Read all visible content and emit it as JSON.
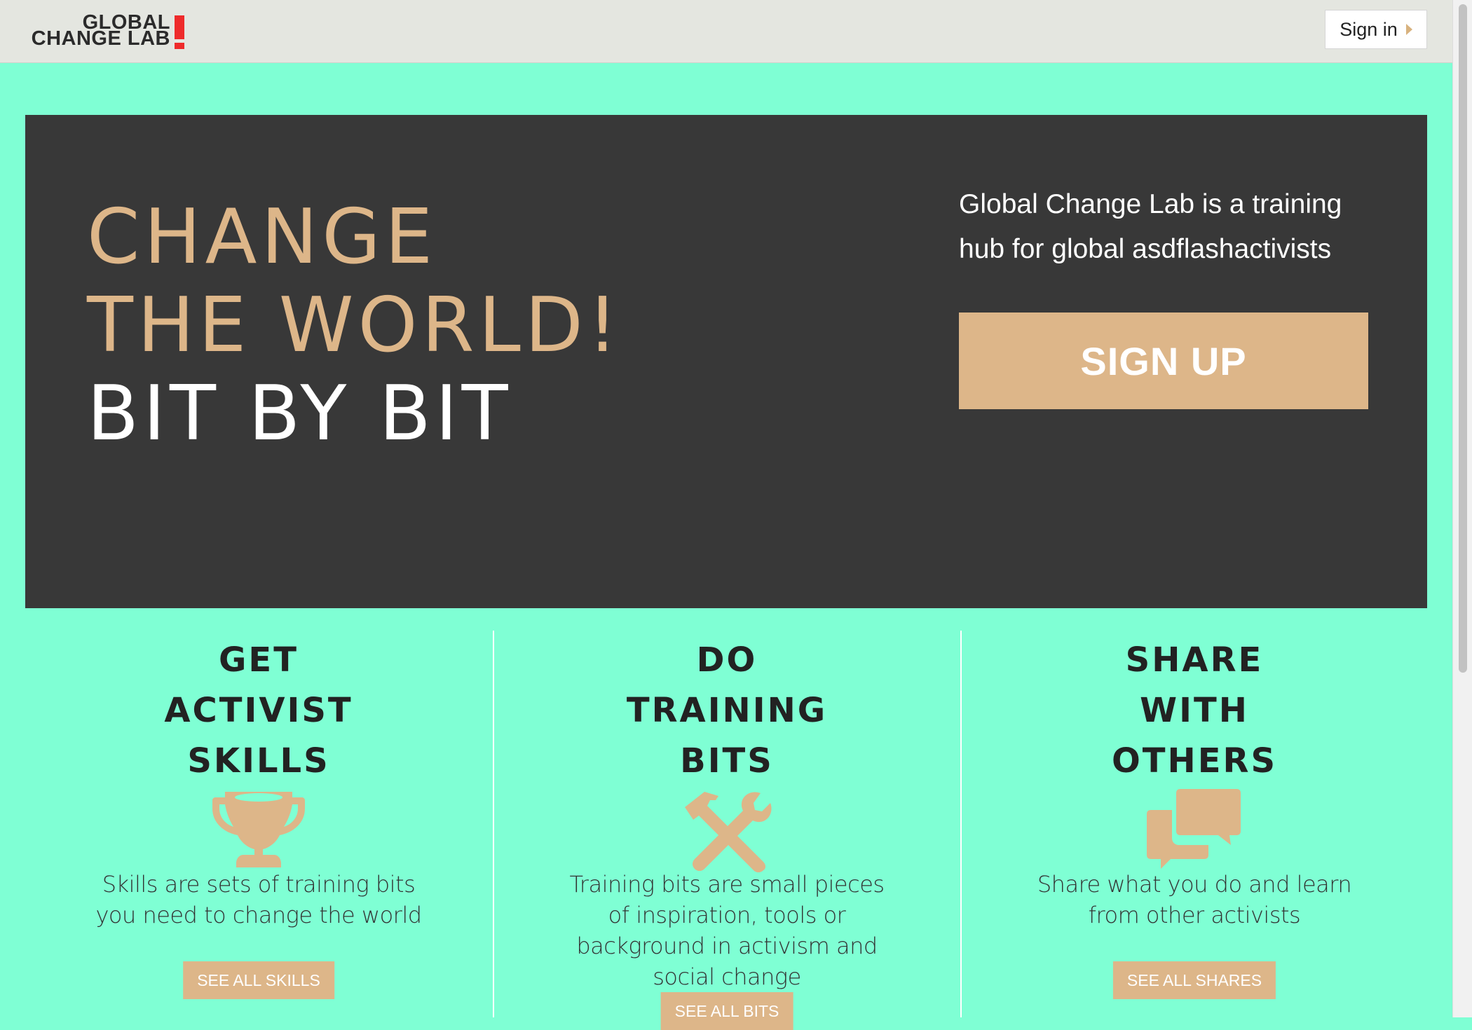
{
  "header": {
    "logo": {
      "line1": "GLOBAL",
      "line2": "CHANGE LAB"
    },
    "signin_label": "Sign in",
    "signin_icon": "caret-right-icon"
  },
  "hero": {
    "headline_line1": "CHANGE",
    "headline_line2": "THE WORLD!",
    "headline_line3": "BIT BY BIT",
    "intro": "Global Change Lab is a training hub for global asdflashactivists",
    "signup_label": "SIGN UP"
  },
  "features": [
    {
      "title": [
        "GET",
        "ACTIVIST",
        "SKILLS"
      ],
      "icon": "trophy-icon",
      "description": "Skills are sets of training bits you need to change the world",
      "button_label": "SEE ALL SKILLS"
    },
    {
      "title": [
        "DO",
        "TRAINING",
        "BITS"
      ],
      "icon": "hammer-wrench-icon",
      "description": "Training bits are small pieces of inspiration, tools or background in activism and social change",
      "button_label": "SEE ALL BITS"
    },
    {
      "title": [
        "SHARE",
        "WITH",
        "OTHERS"
      ],
      "icon": "speech-bubbles-icon",
      "description": "Share what you do and learn from other activists",
      "button_label": "SEE ALL SHARES"
    }
  ],
  "colors": {
    "page_bg": "#7fffd4",
    "hero_bg": "#383838",
    "accent_tan": "#ddb689",
    "logo_red": "#ee2b2b",
    "topbar_bg": "#e4e6e0"
  }
}
